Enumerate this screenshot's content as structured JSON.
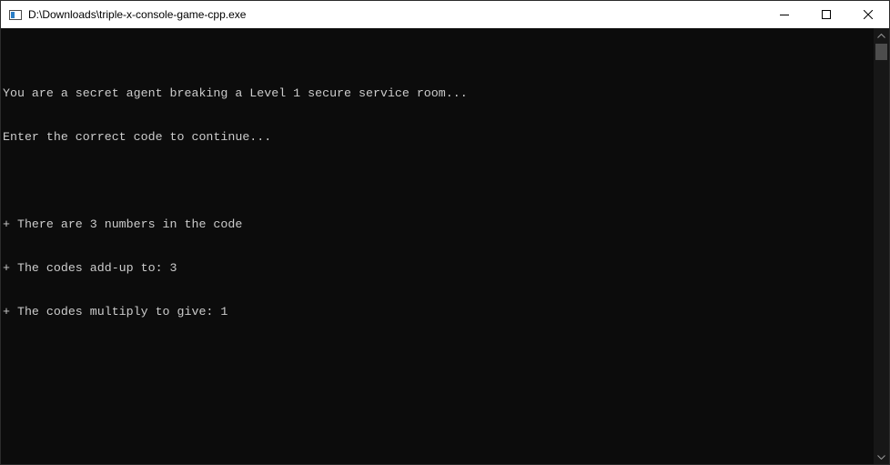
{
  "window": {
    "title": "D:\\Downloads\\triple-x-console-game-cpp.exe",
    "icon": "console-app-icon",
    "controls": {
      "minimize_icon": "minimize-icon",
      "maximize_icon": "maximize-icon",
      "close_icon": "close-icon"
    }
  },
  "console": {
    "text_color": "#cccccc",
    "background": "#0c0c0c",
    "lines": [
      "You are a secret agent breaking a Level 1 secure service room...",
      "Enter the correct code to continue...",
      "",
      "+ There are 3 numbers in the code",
      "+ The codes add-up to: 3",
      "+ The codes multiply to give: 1"
    ]
  },
  "scrollbar": {
    "up_icon": "scroll-up-arrow-icon",
    "down_icon": "scroll-down-arrow-icon"
  }
}
